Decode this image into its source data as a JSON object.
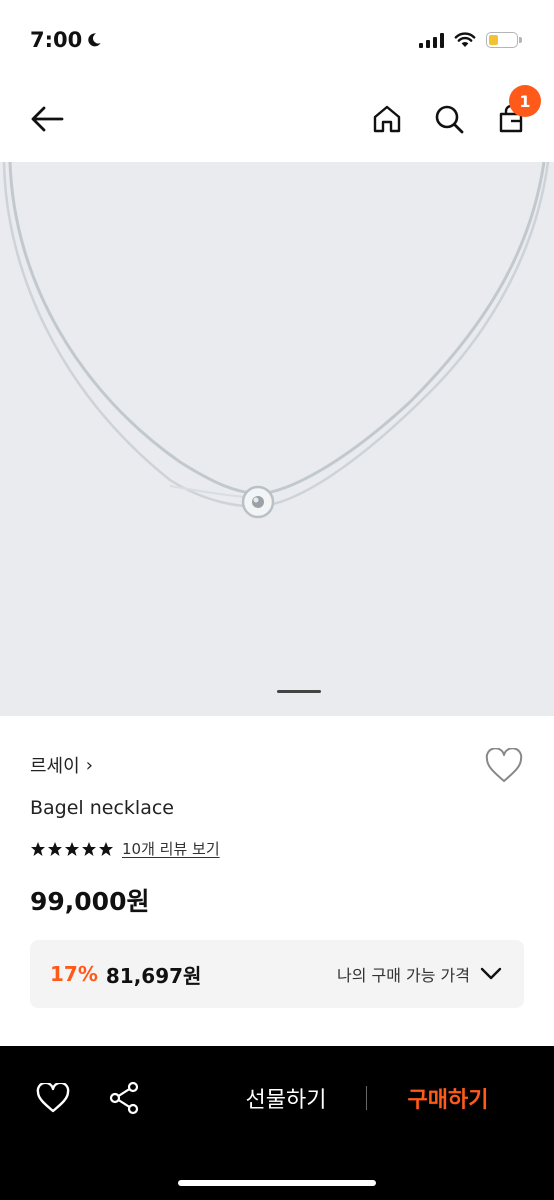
{
  "status_bar": {
    "time": "7:00",
    "battery_color": "#f2c230"
  },
  "nav": {
    "cart_count": "1",
    "badge_color": "#ff5a1a",
    "icons": [
      "back-arrow-icon",
      "home-icon",
      "search-icon",
      "cart-icon"
    ]
  },
  "product": {
    "brand": "르세이",
    "brand_chevron": "›",
    "title": "Bagel necklace",
    "rating_stars": 5,
    "review_link": "10개 리뷰 보기",
    "price": "99,000원"
  },
  "my_price": {
    "discount": "17%",
    "discounted_price": "81,697원",
    "label": "나의 구매 가능 가격"
  },
  "bottom_bar": {
    "gift_label": "선물하기",
    "buy_label": "구매하기",
    "accent_color": "#ff5a1a"
  }
}
